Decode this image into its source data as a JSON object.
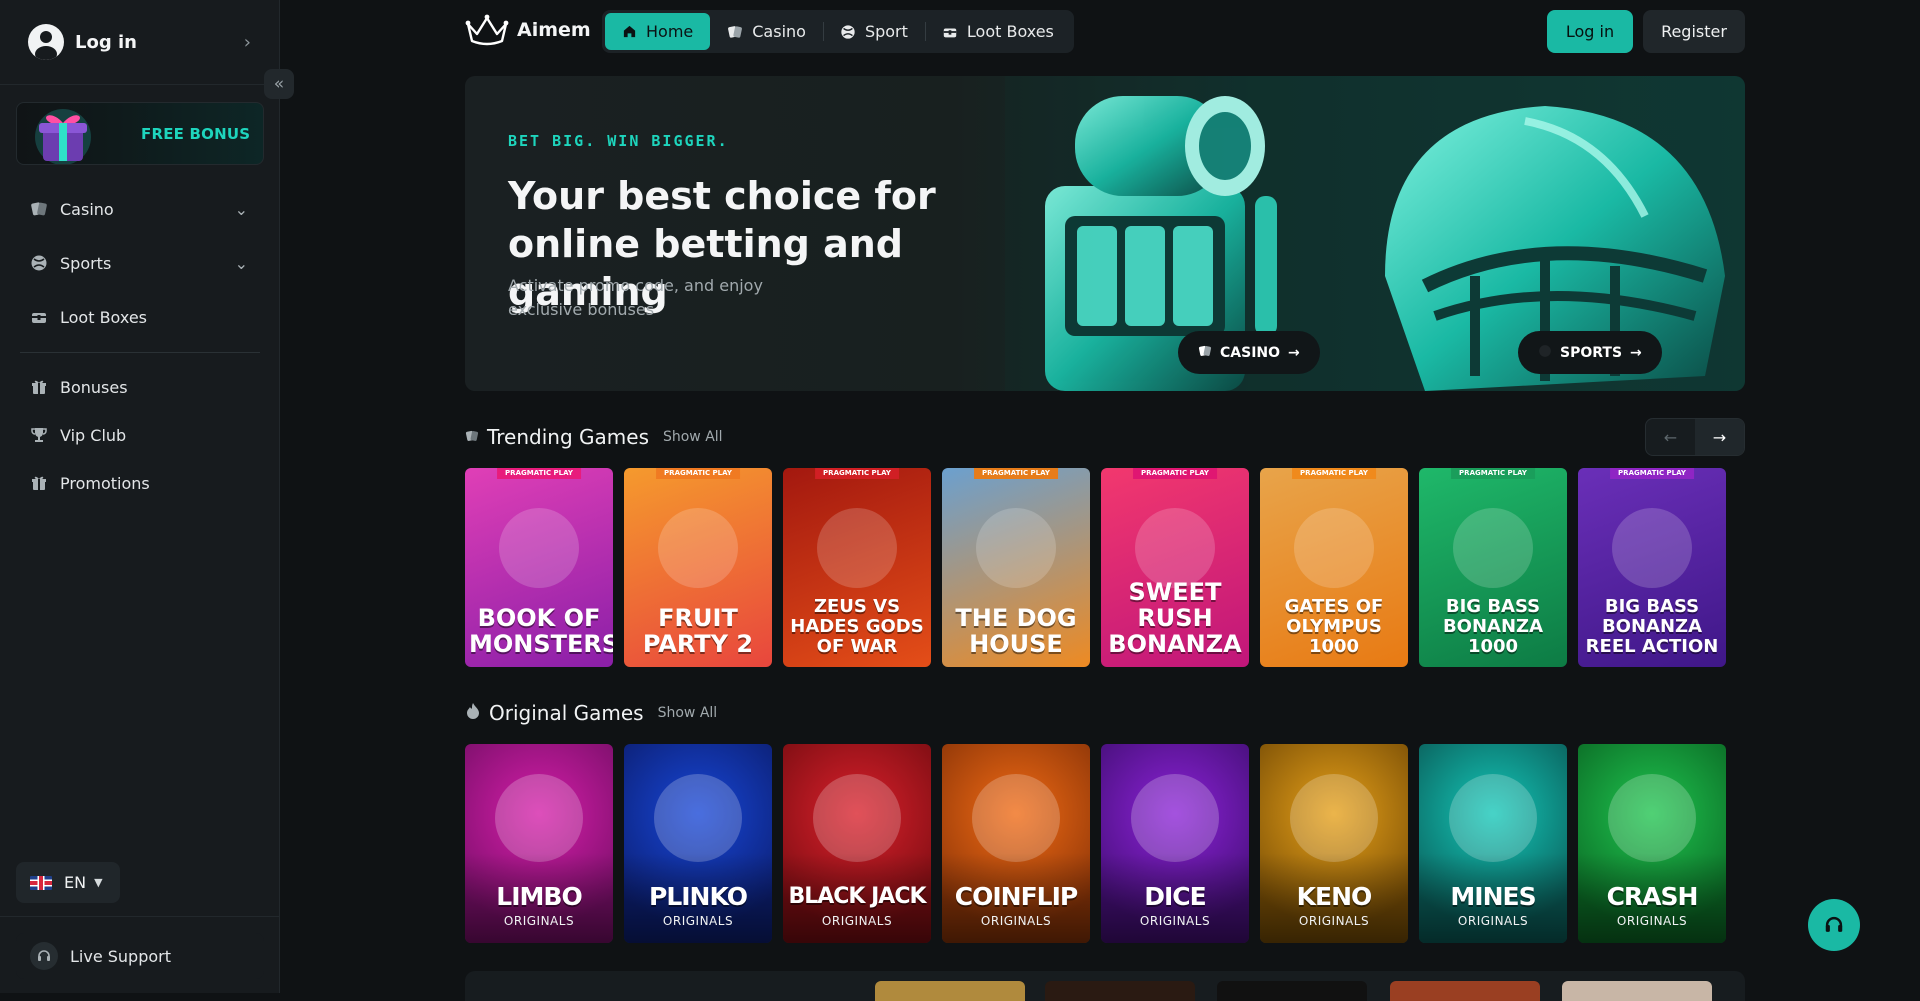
{
  "sidebar": {
    "login_label": "Log in",
    "bonus_label": "FREE BONUS",
    "nav": [
      {
        "label": "Casino",
        "icon": "cards-icon"
      },
      {
        "label": "Sports",
        "icon": "ball-icon"
      },
      {
        "label": "Loot Boxes",
        "icon": "chest-icon"
      }
    ],
    "nav2": [
      {
        "label": "Bonuses",
        "icon": "gift-icon"
      },
      {
        "label": "Vip Club",
        "icon": "trophy-icon"
      },
      {
        "label": "Promotions",
        "icon": "gift-icon"
      }
    ],
    "language": "EN",
    "support_label": "Live Support"
  },
  "header": {
    "brand": "Aimem",
    "tabs": [
      {
        "label": "Home",
        "icon": "home-icon",
        "active": true
      },
      {
        "label": "Casino",
        "icon": "cards-icon"
      },
      {
        "label": "Sport",
        "icon": "ball-icon"
      },
      {
        "label": "Loot Boxes",
        "icon": "chest-icon"
      }
    ],
    "login_label": "Log in",
    "register_label": "Register"
  },
  "hero": {
    "kicker": "BET BIG. WIN BIGGER.",
    "title": "Your best choice for online betting and gaming",
    "subtitle": "Activate promo code, and enjoy exclusive bonuses",
    "casino_button": "CASINO",
    "sports_button": "SPORTS"
  },
  "trending": {
    "title": "Trending Games",
    "show_all": "Show All",
    "provider": "PRAGMATIC PLAY",
    "games": [
      {
        "name": "BOOK OF MONSTERS",
        "bg1": "#e03fb6",
        "bg2": "#8a1fa8",
        "tag": "#e81c7c"
      },
      {
        "name": "FRUIT PARTY 2",
        "bg1": "#f59a2d",
        "bg2": "#e8463d",
        "tag": "#f07a22"
      },
      {
        "name": "ZEUS VS HADES GODS OF WAR",
        "bg1": "#a3180f",
        "bg2": "#e44e18",
        "tag": "#d11f24"
      },
      {
        "name": "THE DOG HOUSE",
        "bg1": "#6ba0cf",
        "bg2": "#ee8a22",
        "tag": "#e67c1a"
      },
      {
        "name": "SWEET RUSH BONANZA",
        "bg1": "#f2386e",
        "bg2": "#c0167a",
        "tag": "#e01672"
      },
      {
        "name": "GATES OF OLYMPUS 1000",
        "bg1": "#e8a44a",
        "bg2": "#e87a13",
        "tag": "#f08a1c"
      },
      {
        "name": "BIG BASS BONANZA 1000",
        "bg1": "#1fb86a",
        "bg2": "#0d7b44",
        "tag": "#1a9e5b"
      },
      {
        "name": "BIG BASS BONANZA REEL ACTION",
        "bg1": "#6a2fb8",
        "bg2": "#3f1788",
        "tag": "#8f25c4"
      }
    ]
  },
  "originals": {
    "title": "Original Games",
    "show_all": "Show All",
    "subtitle": "ORIGINALS",
    "games": [
      {
        "name": "LIMBO",
        "bg1": "#d41ea8",
        "bg2": "#7a0f6a"
      },
      {
        "name": "PLINKO",
        "bg1": "#1746d6",
        "bg2": "#0c1f73"
      },
      {
        "name": "BLACK JACK",
        "bg1": "#d9202b",
        "bg2": "#7a0d12"
      },
      {
        "name": "COINFLIP",
        "bg1": "#f06a14",
        "bg2": "#8c3508"
      },
      {
        "name": "DICE",
        "bg1": "#8b22d6",
        "bg2": "#450f78"
      },
      {
        "name": "KENO",
        "bg1": "#e6a019",
        "bg2": "#7a4f06"
      },
      {
        "name": "MINES",
        "bg1": "#14c7b8",
        "bg2": "#0a5e5a"
      },
      {
        "name": "CRASH",
        "bg1": "#1fc44f",
        "bg2": "#0b6a25"
      }
    ]
  },
  "colors": {
    "accent": "#1ab9a4",
    "background": "#0f1214",
    "sidebar": "#171b1e"
  }
}
